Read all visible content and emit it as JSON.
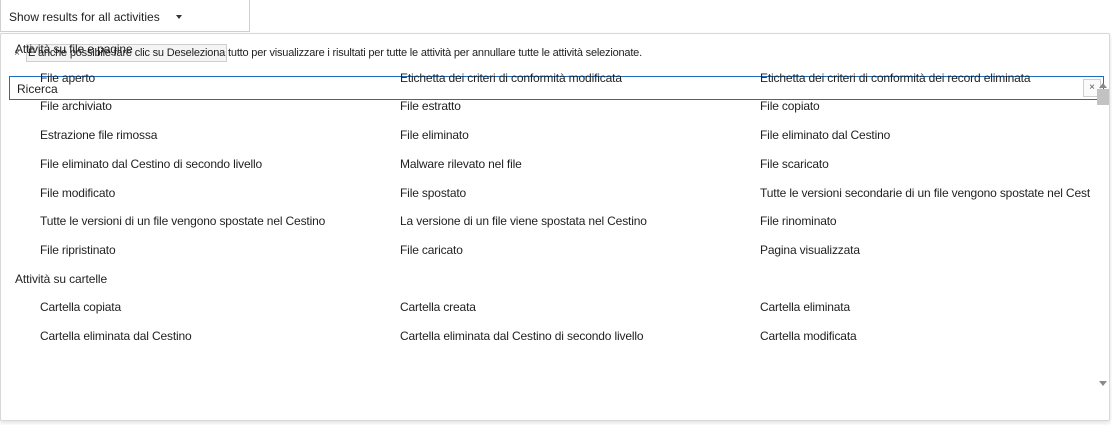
{
  "dropdown": {
    "label": "Show results for all activities"
  },
  "info": {
    "close_glyph": "×",
    "deselect_label": "È anche possibile fare clic su Deseleziona",
    "rest_text": "tutto per visualizzare i risultati per tutte le attività per annullare tutte le attività selezionate."
  },
  "search": {
    "value": "Ricerca",
    "clear_glyph": "×"
  },
  "groups": [
    {
      "title": "Attività su file e pagine",
      "rows": [
        [
          "File aperto",
          "Etichetta dei criteri di conformità modificata",
          "Etichetta dei criteri di conformità dei record eliminata"
        ],
        [
          "File archiviato",
          "File estratto",
          "File copiato"
        ],
        [
          "Estrazione file rimossa",
          "File eliminato",
          "File eliminato dal Cestino"
        ],
        [
          "File eliminato dal Cestino di secondo livello",
          "Malware rilevato nel file",
          "File scaricato"
        ],
        [
          "File modificato",
          "File spostato",
          "Tutte le versioni secondarie di un file vengono spostate nel Cestino"
        ],
        [
          "Tutte le versioni di un file vengono spostate nel Cestino",
          "La versione di un file viene spostata nel Cestino",
          "File rinominato"
        ],
        [
          "File ripristinato",
          "File caricato",
          "Pagina visualizzata"
        ]
      ]
    },
    {
      "title": "Attività su cartelle",
      "rows": [
        [
          "Cartella copiata",
          "Cartella creata",
          "Cartella eliminata"
        ],
        [
          "Cartella eliminata dal Cestino",
          "Cartella eliminata dal Cestino di secondo livello",
          "Cartella modificata"
        ]
      ]
    }
  ]
}
